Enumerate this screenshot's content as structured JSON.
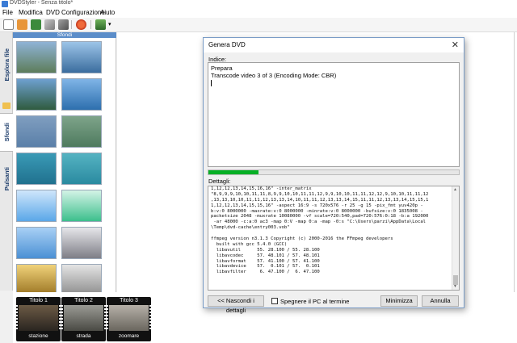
{
  "window": {
    "title": "DVDStyler - Senza titolo*"
  },
  "menu": [
    "File",
    "Modifica",
    "DVD",
    "Configurazione",
    "Aiuto"
  ],
  "sidebar_tabs": [
    "Esplora file",
    "Sfondi",
    "Pulsanti"
  ],
  "backgrounds_panel": {
    "header": "Sfondi",
    "thumbnails": [
      {
        "name": "coast-1",
        "colors": [
          "#8fb3d6",
          "#5d7d5a"
        ]
      },
      {
        "name": "harbor",
        "colors": [
          "#9cc4e8",
          "#3b6d9e"
        ]
      },
      {
        "name": "coast-2",
        "colors": [
          "#6ea0d0",
          "#2f5b3e"
        ]
      },
      {
        "name": "blue-sky",
        "colors": [
          "#7fb4e6",
          "#2d6fae"
        ]
      },
      {
        "name": "blue-blur",
        "colors": [
          "#7f9ec0",
          "#5a7fa8"
        ]
      },
      {
        "name": "green-blur",
        "colors": [
          "#7ea48a",
          "#4e7a5e"
        ]
      },
      {
        "name": "teal-water",
        "colors": [
          "#3a9ab6",
          "#20718e"
        ]
      },
      {
        "name": "teal-ripple",
        "colors": [
          "#55b3c2",
          "#2a8aa0"
        ]
      },
      {
        "name": "blue-frame",
        "colors": [
          "#cfe6fb",
          "#5aa7e8"
        ]
      },
      {
        "name": "green-frame",
        "colors": [
          "#d4f3e6",
          "#3cbf8c"
        ]
      },
      {
        "name": "blue-gradient",
        "colors": [
          "#a8d0f5",
          "#4b90d4"
        ]
      },
      {
        "name": "gray-frame",
        "colors": [
          "#e6e6ea",
          "#7e7e86"
        ]
      },
      {
        "name": "gold",
        "colors": [
          "#f0d27a",
          "#9a7422"
        ]
      },
      {
        "name": "silver",
        "colors": [
          "#e4e4e4",
          "#8c8c8c"
        ]
      }
    ]
  },
  "titles": [
    {
      "head": "Titolo 1",
      "foot": "stazione",
      "colors": [
        "#6b5a45",
        "#2a2520"
      ]
    },
    {
      "head": "Titolo 2",
      "foot": "strada",
      "colors": [
        "#9a9a94",
        "#4a4a44"
      ]
    },
    {
      "head": "Titolo 3",
      "foot": "zoomare",
      "colors": [
        "#b5b0a8",
        "#6a665e"
      ]
    }
  ],
  "dialog": {
    "title": "Genera DVD",
    "index_label": "Indice:",
    "index_lines": [
      "Prepara",
      "Transcode video 3 of 3 (Encoding Mode: CBR)"
    ],
    "progress": 0.2,
    "details_label": "Dettagli:",
    "details_lines": [
      "1,12,12,13,14,15,16,16\" -inter_matrix",
      "\"8,9,9,9,10,10,11,11,8,9,9,10,10,11,11,12,9,9,10,10,11,11,12,12,9,10,10,11,11,12",
      ",13,13,10,10,11,11,12,13,13,14,10,11,11,12,13,13,14,15,11,11,12,13,13,14,15,15,1",
      "1,12,12,13,14,15,15,16\" -aspect 16:9 -s 720x576 -r 25 -g 15 -pix_fmt yuv420p -",
      "b:v:0 8000000 -maxrate:v:0 8000000 -minrate:v:0 8000000 -bufsize:v:0 1835008 -",
      "packetsize 2048 -muxrate 10080000 -vf scale=720:540,pad=720:576:0:18 -b:a 192000",
      " -ar 48000 -c:a:0 ac3 -map 0:V -map 0:a -map -0:s \"C:\\Users\\parzi\\AppData\\Local",
      "\\Temp\\dvd-cache\\entry003.vob\"",
      "",
      "ffmpeg version n3.1.3 Copyright (c) 2000-2016 the FFmpeg developers",
      "  built with gcc 5.4.0 (GCC)",
      "  libavutil      55. 28.100 / 55. 28.100",
      "  libavcodec     57. 48.101 / 57. 48.101",
      "  libavformat    57. 41.100 / 57. 41.100",
      "  libavdevice    57.  0.101 / 57.  0.101",
      "  libavfilter     6. 47.100 /  6. 47.100"
    ],
    "hide_details_button": "<< Nascondi i dettagli",
    "shutdown_checkbox": "Spegnere il PC al termine",
    "minimize_button": "Minimizza",
    "cancel_button": "Annulla"
  }
}
